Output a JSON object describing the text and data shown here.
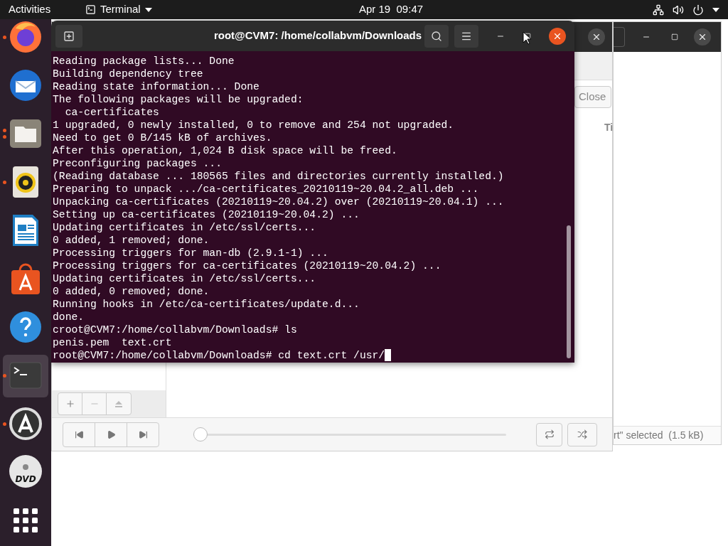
{
  "top_bar": {
    "activities": "Activities",
    "app_menu": "Terminal",
    "clock": "Apr 19  09:47"
  },
  "dock": [
    {
      "kind": "firefox",
      "running": true,
      "multiple_windows": false,
      "selected": false
    },
    {
      "kind": "thunderbird",
      "running": false,
      "selected": false
    },
    {
      "kind": "files",
      "running": true,
      "multiple_windows": true,
      "selected": false
    },
    {
      "kind": "rhythmbox",
      "running": true,
      "multiple_windows": false,
      "selected": false
    },
    {
      "kind": "writer",
      "running": false,
      "selected": false
    },
    {
      "kind": "software",
      "running": false,
      "selected": false
    },
    {
      "kind": "help",
      "running": false,
      "selected": false
    },
    {
      "kind": "terminal",
      "running": true,
      "multiple_windows": false,
      "selected": true
    },
    {
      "kind": "updater",
      "running": true,
      "multiple_windows": false,
      "selected": false
    },
    {
      "kind": "dvd",
      "running": false,
      "selected": false,
      "label": "DVD"
    },
    {
      "kind": "apps",
      "running": false,
      "selected": false
    }
  ],
  "music_window": {
    "button": "Close",
    "column_heading": "Ti",
    "player": {
      "level": 0
    }
  },
  "files_window": {
    "status": "rt\" selected  (1.5 kB)"
  },
  "terminal": {
    "title": "root@CVM7: /home/collabvm/Downloads",
    "lines": [
      "Reading package lists... Done",
      "Building dependency tree",
      "Reading state information... Done",
      "The following packages will be upgraded:",
      "  ca-certificates",
      "1 upgraded, 0 newly installed, 0 to remove and 254 not upgraded.",
      "Need to get 0 B/145 kB of archives.",
      "After this operation, 1,024 B disk space will be freed.",
      "Preconfiguring packages ...",
      "(Reading database ... 180565 files and directories currently installed.)",
      "Preparing to unpack .../ca-certificates_20210119~20.04.2_all.deb ...",
      "Unpacking ca-certificates (20210119~20.04.2) over (20210119~20.04.1) ...",
      "Setting up ca-certificates (20210119~20.04.2) ...",
      "Updating certificates in /etc/ssl/certs...",
      "0 added, 1 removed; done.",
      "Processing triggers for man-db (2.9.1-1) ...",
      "Processing triggers for ca-certificates (20210119~20.04.2) ...",
      "Updating certificates in /etc/ssl/certs...",
      "0 added, 0 removed; done.",
      "Running hooks in /etc/ca-certificates/update.d...",
      "done.",
      "croot@CVM7:/home/collabvm/Downloads# ls",
      "penis.pem  text.crt",
      "root@CVM7:/home/collabvm/Downloads# cd text.crt /usr/"
    ]
  }
}
